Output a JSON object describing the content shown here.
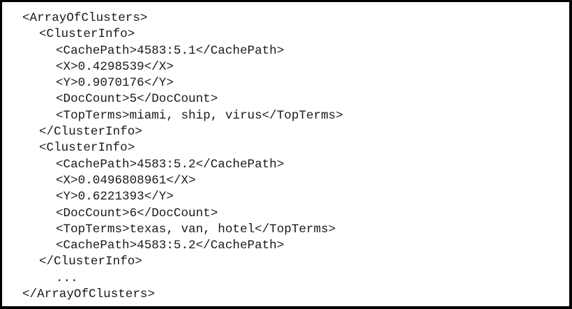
{
  "lines": [
    "<ArrayOfClusters>",
    "<ClusterInfo>",
    "<CachePath>4583:5.1</CachePath>",
    "<X>0.4298539</X>",
    "<Y>0.9070176</Y>",
    "<DocCount>5</DocCount>",
    "<TopTerms>miami, ship, virus</TopTerms>",
    "</ClusterInfo>",
    "<ClusterInfo>",
    "<CachePath>4583:5.2</CachePath>",
    "<X>0.0496808961</X>",
    "<Y>0.6221393</Y>",
    "<DocCount>6</DocCount>",
    "<TopTerms>texas, van, hotel</TopTerms>",
    "<CachePath>4583:5.2</CachePath>",
    "</ClusterInfo>",
    "...",
    "</ArrayOfClusters>"
  ]
}
